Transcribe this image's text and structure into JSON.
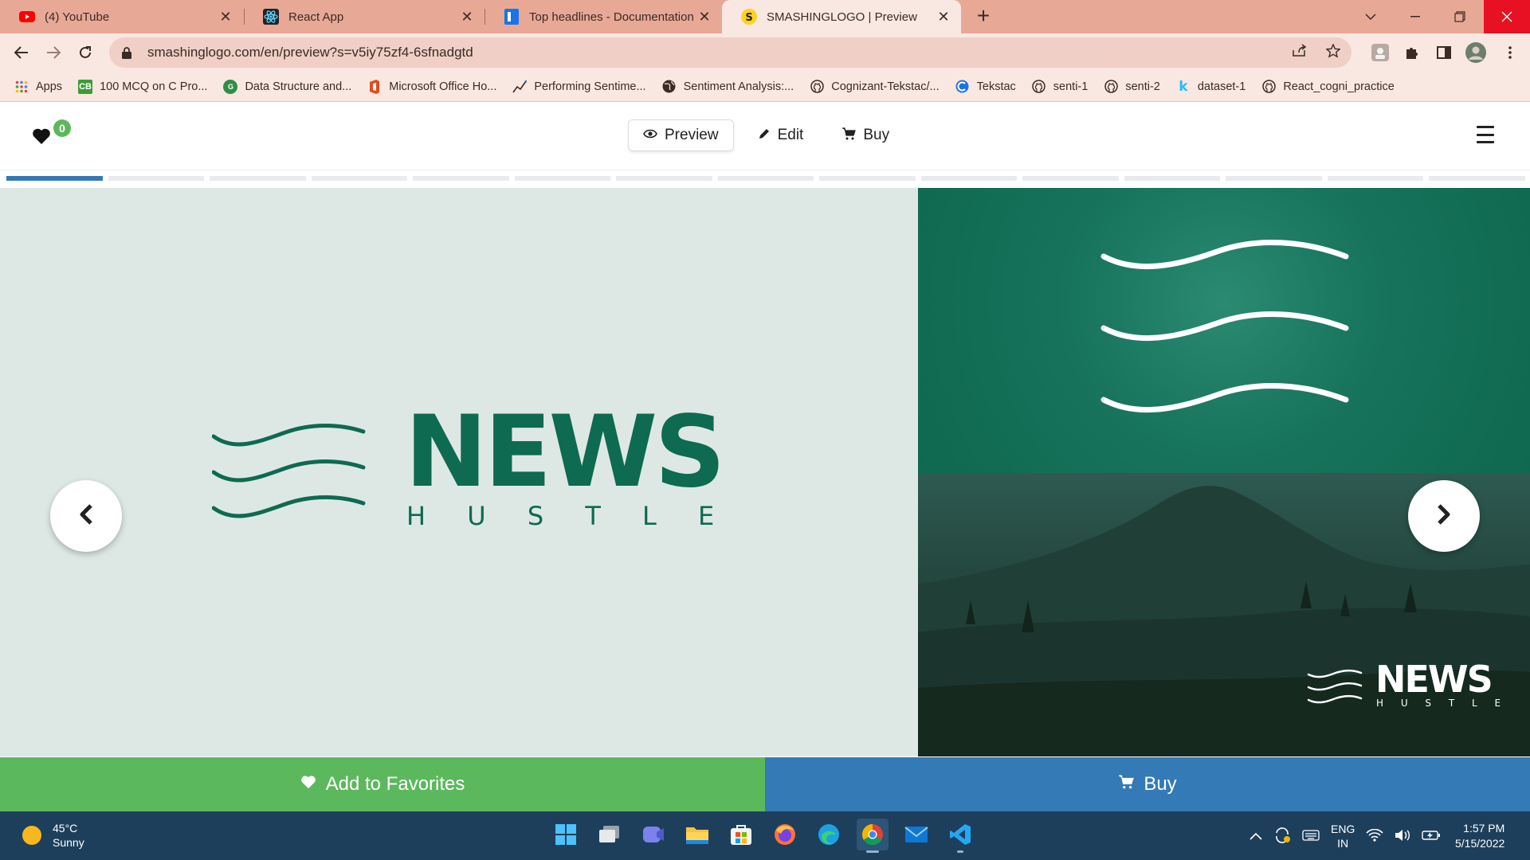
{
  "browser": {
    "tabs": [
      {
        "title": "(4) YouTube",
        "icon": "youtube-icon"
      },
      {
        "title": "React App",
        "icon": "react-icon"
      },
      {
        "title": "Top headlines - Documentation - ",
        "icon": "document-icon"
      },
      {
        "title": "SMASHINGLOGO | Preview",
        "icon": "smashinglogo-icon",
        "active": true
      }
    ],
    "url": "smashinglogo.com/en/preview?s=v5iy75zf4-6sfnadgtd",
    "bookmarks": [
      {
        "label": "Apps",
        "icon": "apps-grid-icon"
      },
      {
        "label": "100 MCQ on C Pro...",
        "icon": "cb-icon"
      },
      {
        "label": "Data Structure and...",
        "icon": "gfg-icon"
      },
      {
        "label": "Microsoft Office Ho...",
        "icon": "office-icon"
      },
      {
        "label": "Performing Sentime...",
        "icon": "chart-icon"
      },
      {
        "label": "Sentiment Analysis:...",
        "icon": "globe-icon"
      },
      {
        "label": "Cognizant-Tekstac/...",
        "icon": "github-icon"
      },
      {
        "label": "Tekstac",
        "icon": "tekstac-icon"
      },
      {
        "label": "senti-1",
        "icon": "github-icon"
      },
      {
        "label": "senti-2",
        "icon": "github-icon"
      },
      {
        "label": "dataset-1",
        "icon": "kaggle-icon"
      },
      {
        "label": "React_cogni_practice",
        "icon": "github-icon"
      }
    ]
  },
  "site": {
    "favorites_count": "0",
    "nav": {
      "preview": "Preview",
      "edit": "Edit",
      "buy": "Buy"
    },
    "progress": {
      "total_steps": 15,
      "completed_steps": 1
    },
    "logo": {
      "word": "NEWS",
      "sub": "H U S T L E"
    },
    "actions": {
      "favorites": "Add to Favorites",
      "buy": "Buy"
    },
    "colors": {
      "brand_green": "#0e6a50",
      "favorites_green": "#5cb85c",
      "buy_blue": "#337ab7"
    }
  },
  "taskbar": {
    "weather_temp": "45°C",
    "weather_desc": "Sunny",
    "lang_top": "ENG",
    "lang_bottom": "IN",
    "time": "1:57 PM",
    "date": "5/15/2022"
  }
}
